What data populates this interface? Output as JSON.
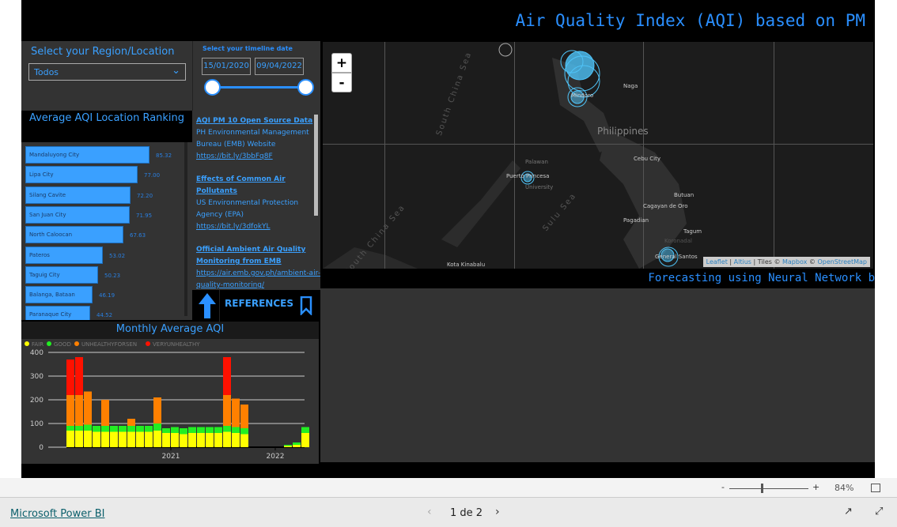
{
  "header": {
    "title": "Air Quality Index (AQI) based on PM"
  },
  "region": {
    "label": "Select your Region/Location",
    "selected": "Todos"
  },
  "timeline": {
    "label": "Select your timeline date",
    "start": "15/01/2020",
    "end": "09/04/2022"
  },
  "ranking": {
    "title": "Average AQI Location Ranking",
    "max": 85.32,
    "items": [
      {
        "name": "Mandaluyong City",
        "value": "85.32"
      },
      {
        "name": "Lipa City",
        "value": "77.00"
      },
      {
        "name": "Silang Cavite",
        "value": "72.20"
      },
      {
        "name": "San Juan City",
        "value": "71.95"
      },
      {
        "name": "North Caloocan",
        "value": "67.63"
      },
      {
        "name": "Pateros",
        "value": "53.02"
      },
      {
        "name": "Taguig City",
        "value": "50.23"
      },
      {
        "name": "Balanga, Bataan",
        "value": "46.19"
      },
      {
        "name": "Paranaque City",
        "value": "44.52"
      }
    ]
  },
  "references": {
    "label": "REFERENCES",
    "items": [
      {
        "title": "AQI PM 10 Open Source Data",
        "source": "PH Environmental Management Bureau (EMB) Website",
        "link": "https://bit.ly/3bbFq8F"
      },
      {
        "title": "Effects of Common Air Pollutants",
        "source": "US Environmental Protection Agency (EPA)",
        "link": "https://bit.ly/3dfokYL"
      },
      {
        "title": "Official Ambient Air Quality Monitoring from EMB",
        "source": "",
        "link": "https://air.emb.gov.ph/ambient-air-quality-monitoring/"
      }
    ]
  },
  "map": {
    "zoom_in": "+",
    "zoom_out": "-",
    "labels": [
      "Philippines",
      "Naga",
      "Mindoro",
      "Palawan",
      "Puerto Princesa",
      "University",
      "Cebu City",
      "Butuan",
      "Cagayan de Oro",
      "Pagadian",
      "Tagum",
      "Koronadal",
      "General Santos",
      "Kota Kinabalu"
    ],
    "seas": [
      "South China Sea",
      "South China Sea",
      "Sulu Sea"
    ],
    "attribution": {
      "leaflet": "Leaflet",
      "altius": "Altius",
      "tiles": "Tiles ©",
      "mapbox": "Mapbox",
      "sep": "©",
      "osm": "OpenStreetMap"
    },
    "marker_color": "#4fc3f7"
  },
  "forecast": {
    "title": "Forecasting using Neural Network b"
  },
  "chart_data": {
    "type": "bar",
    "stacked": true,
    "title": "Monthly Average AQI",
    "legend": {
      "placement": "top-left",
      "entries": [
        {
          "name": "FAIR",
          "color": "#ffff00"
        },
        {
          "name": "GOOD",
          "color": "#22ee22"
        },
        {
          "name": "UNHEALTHYFORSEN",
          "color": "#ff8000"
        },
        {
          "name": "VERYUNHEALTHY",
          "color": "#ff1100"
        }
      ]
    },
    "ylim": [
      0,
      400
    ],
    "yticks": [
      "0",
      "100",
      "200",
      "300",
      "400"
    ],
    "xticks": [
      "2021",
      "2022"
    ],
    "grid": true,
    "x": [
      "2020-01",
      "2020-02",
      "2020-03",
      "2020-04",
      "2020-05",
      "2020-06",
      "2020-07",
      "2020-08",
      "2020-09",
      "2020-10",
      "2020-11",
      "2020-12",
      "2021-01",
      "2021-02",
      "2021-03",
      "2021-04",
      "2021-05",
      "2021-06",
      "2021-07",
      "2021-08",
      "2021-09",
      "2022-02",
      "2022-03",
      "2022-04"
    ],
    "series": [
      {
        "name": "FAIR",
        "values": [
          70,
          70,
          70,
          65,
          65,
          65,
          65,
          65,
          65,
          65,
          70,
          60,
          60,
          55,
          60,
          60,
          60,
          60,
          65,
          60,
          55,
          5,
          10,
          60
        ]
      },
      {
        "name": "GOOD",
        "values": [
          20,
          20,
          25,
          25,
          25,
          25,
          25,
          25,
          25,
          25,
          30,
          20,
          25,
          25,
          25,
          25,
          25,
          25,
          25,
          25,
          25,
          5,
          10,
          25
        ]
      },
      {
        "name": "UNHEALTHYFORSEN",
        "values": [
          130,
          130,
          140,
          0,
          110,
          0,
          0,
          30,
          0,
          0,
          110,
          0,
          0,
          0,
          0,
          0,
          0,
          0,
          130,
          120,
          100,
          0,
          0,
          0
        ]
      },
      {
        "name": "VERYUNHEALTHY",
        "values": [
          150,
          160,
          0,
          0,
          0,
          0,
          0,
          0,
          0,
          0,
          0,
          0,
          0,
          0,
          0,
          0,
          0,
          0,
          160,
          0,
          0,
          0,
          0,
          0
        ]
      }
    ]
  },
  "footer": {
    "zoom_minus": "-",
    "zoom_plus": "+",
    "zoom_level": "84%",
    "brand": "Microsoft Power BI",
    "page": "1 de 2"
  }
}
